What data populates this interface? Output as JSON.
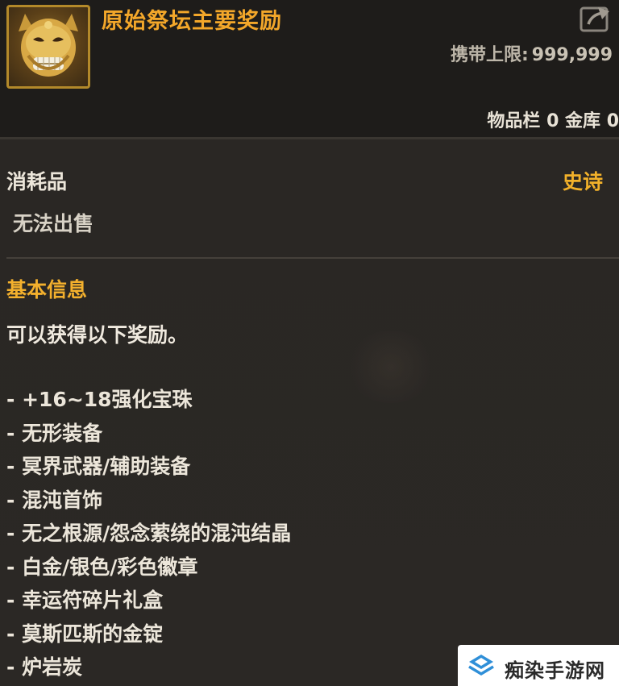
{
  "item": {
    "title": "原始祭坛主要奖励",
    "icon": "golden-demon-mask-icon",
    "carry_limit_label": "携带上限:",
    "carry_limit_value": "999,999",
    "storage_text": "物品栏 0 金库 0",
    "category": "消耗品",
    "rarity": "史诗",
    "trade_status": "无法出售"
  },
  "info": {
    "section_title": "基本信息",
    "description": "可以获得以下奖励。",
    "rewards": [
      "- +16~18强化宝珠",
      "- 无形装备",
      "- 冥界武器/辅助装备",
      "- 混沌首饰",
      "- 无之根源/怨念萦绕的混沌结晶",
      "- 白金/银色/彩色徽章",
      "- 幸运符碎片礼盒",
      "- 莫斯匹斯的金锭",
      "- 炉岩炭"
    ]
  },
  "watermark": {
    "text": "痴染手游网",
    "icon": "site-logo-icon"
  },
  "colors": {
    "title": "#f3a72a",
    "rarity_epic": "#f2b12a",
    "section": "#f3b02d",
    "icon_border": "#b3892a"
  }
}
